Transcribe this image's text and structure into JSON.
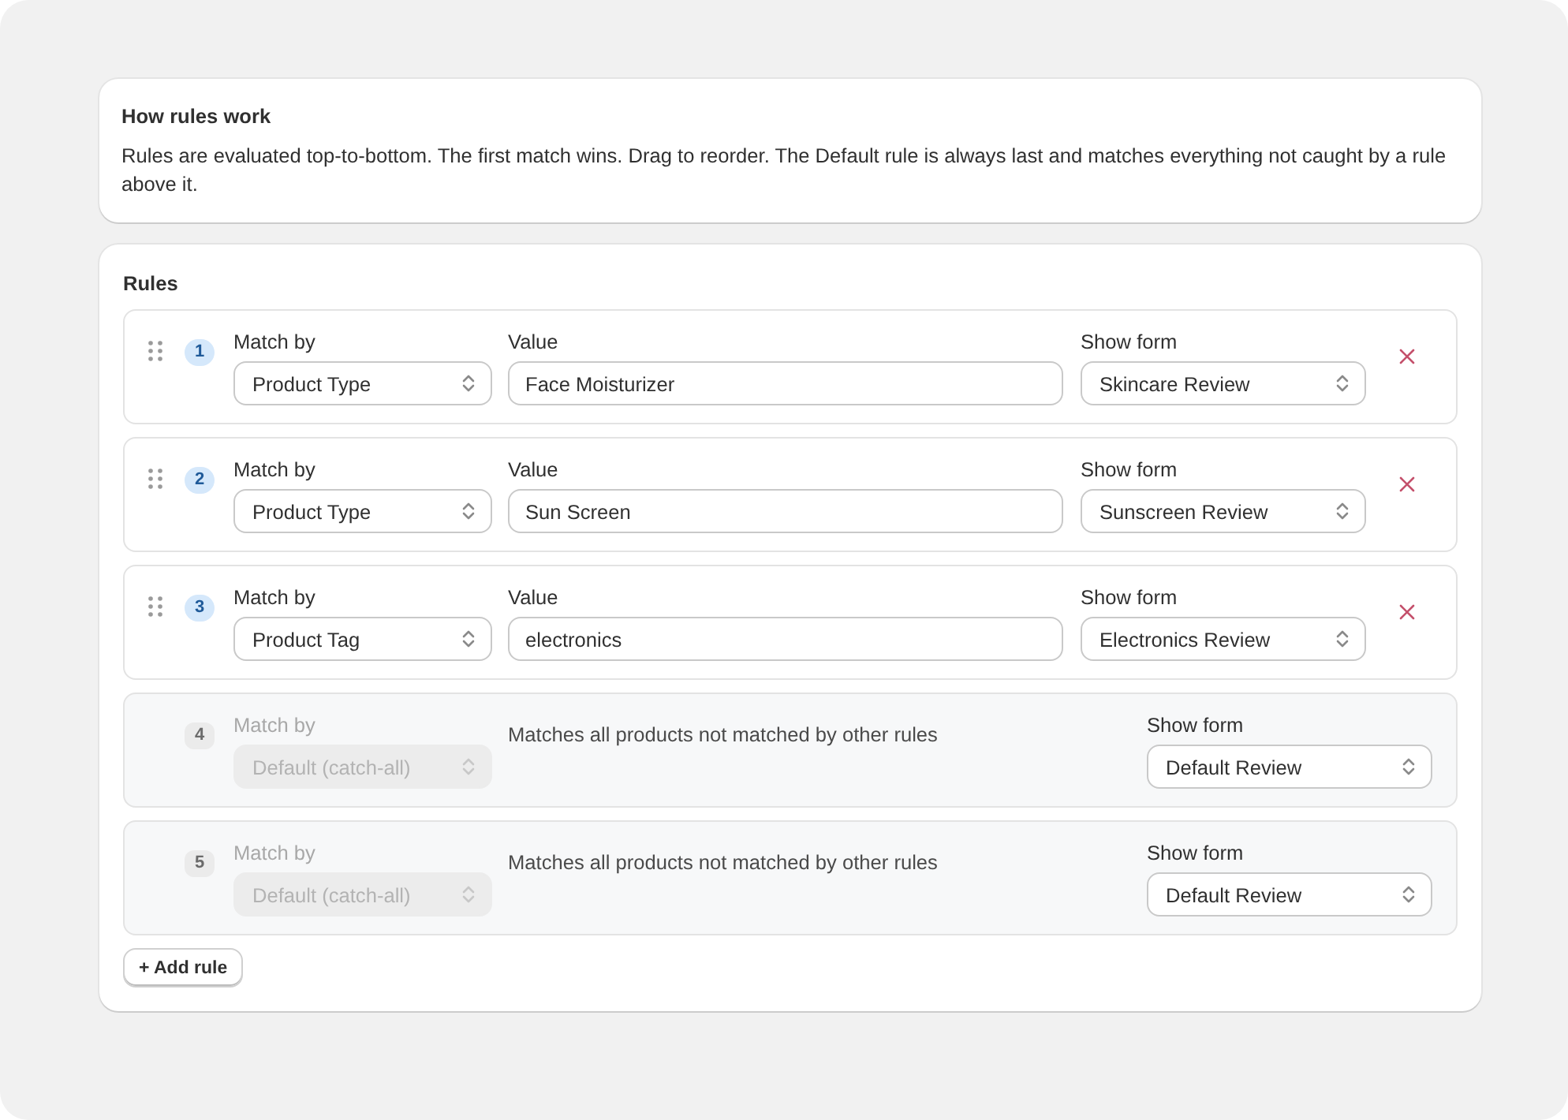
{
  "info": {
    "title": "How rules work",
    "text": "Rules are evaluated top-to-bottom. The first match wins. Drag to reorder. The Default rule is always last and matches everything not caught by a rule above it."
  },
  "rules_section": {
    "title": "Rules",
    "rules": [
      {
        "kind": "custom",
        "number": "1",
        "match_by": {
          "label": "Match by",
          "value": "Product Type",
          "disabled": false
        },
        "value": {
          "label": "Value",
          "value": "Face Moisturizer"
        },
        "show_form": {
          "label": "Show form",
          "value": "Skincare Review"
        }
      },
      {
        "kind": "custom",
        "number": "2",
        "match_by": {
          "label": "Match by",
          "value": "Product Type",
          "disabled": false
        },
        "value": {
          "label": "Value",
          "value": "Sun Screen"
        },
        "show_form": {
          "label": "Show form",
          "value": "Sunscreen Review"
        }
      },
      {
        "kind": "custom",
        "number": "3",
        "match_by": {
          "label": "Match by",
          "value": "Product Tag",
          "disabled": false
        },
        "value": {
          "label": "Value",
          "value": "electronics"
        },
        "show_form": {
          "label": "Show form",
          "value": "Electronics Review"
        }
      },
      {
        "kind": "default",
        "number": "4",
        "match_by": {
          "label": "Match by",
          "value": "Default (catch-all)",
          "disabled": true
        },
        "note": "Matches all products not matched by other rules",
        "show_form": {
          "label": "Show form",
          "value": "Default Review"
        }
      },
      {
        "kind": "default",
        "number": "5",
        "match_by": {
          "label": "Match by",
          "value": "Default (catch-all)",
          "disabled": true
        },
        "note": "Matches all products not matched by other rules",
        "show_form": {
          "label": "Show form",
          "value": "Default Review"
        }
      }
    ],
    "add_button": "+ Add rule"
  }
}
